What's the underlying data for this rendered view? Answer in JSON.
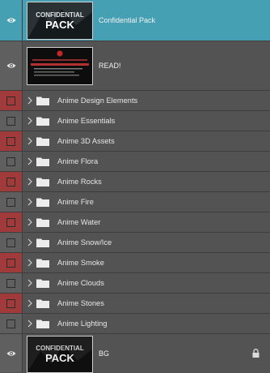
{
  "layers": [
    {
      "name": "Confidential Pack"
    },
    {
      "name": "READ!"
    },
    {
      "name": "BG"
    }
  ],
  "thumb_text": {
    "line1": "CONFIDENTIAL",
    "line2": "PACK"
  },
  "groups": [
    {
      "name": "Anime Design Elements",
      "box": "red"
    },
    {
      "name": "Anime Essentials",
      "box": "grey"
    },
    {
      "name": "Anime 3D Assets",
      "box": "red"
    },
    {
      "name": "Anime Flora",
      "box": "grey"
    },
    {
      "name": "Anime Rocks",
      "box": "red"
    },
    {
      "name": "Anime Fire",
      "box": "grey"
    },
    {
      "name": "Anime Water",
      "box": "red"
    },
    {
      "name": "Anime Snow/Ice",
      "box": "grey"
    },
    {
      "name": "Anime Smoke",
      "box": "red"
    },
    {
      "name": "Anime Clouds",
      "box": "grey"
    },
    {
      "name": "Anime Stones",
      "box": "red"
    },
    {
      "name": "Anime Lighting",
      "box": "grey"
    }
  ],
  "icons": {
    "visibility": "eye-icon",
    "expand": "chevron-right-icon",
    "group": "folder-icon",
    "locked": "lock-icon"
  },
  "colors": {
    "selected": "#46a0b4",
    "red_tag": "#a13a3a",
    "panel": "#535353"
  }
}
